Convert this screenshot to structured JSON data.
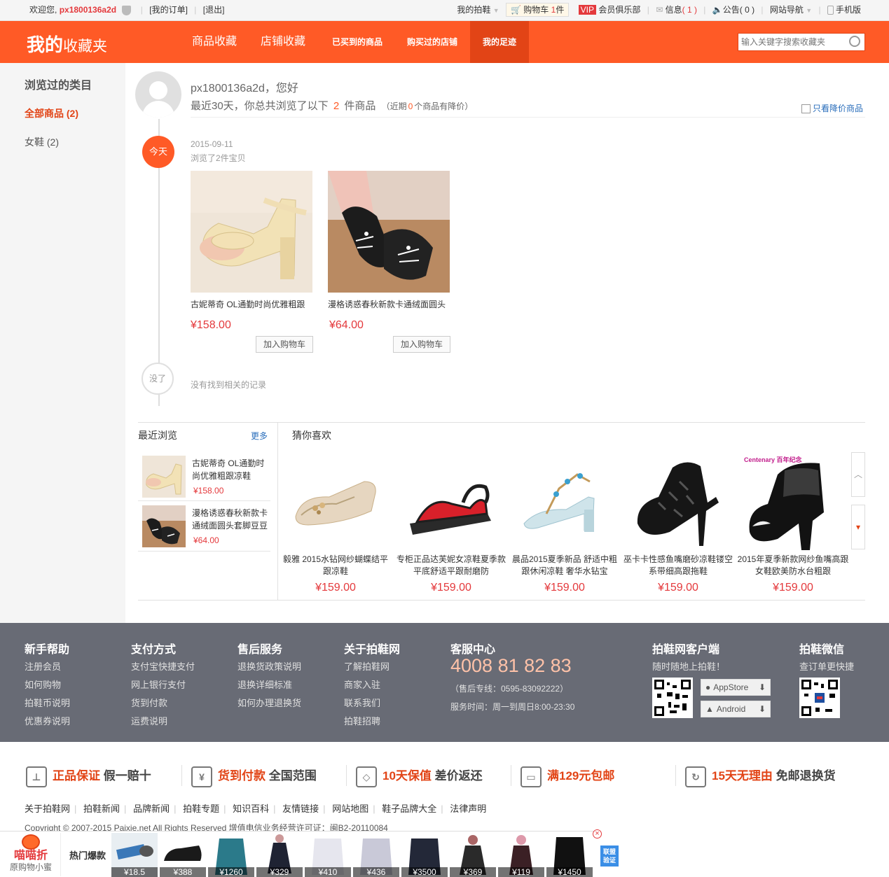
{
  "topbar": {
    "welcome": "欢迎您,",
    "username": "px1800136a2d",
    "my_orders": "[我的订单]",
    "logout": "[退出]",
    "my_paixie": "我的拍鞋",
    "cart_label": "购物车",
    "cart_count": "1",
    "cart_unit": "件",
    "vip_badge": "VIP",
    "vip_club": "会员俱乐部",
    "messages_label": "信息",
    "messages_count": "( 1 )",
    "notice_label": "公告",
    "notice_count": "( 0 )",
    "site_nav": "网站导航",
    "mobile": "手机版"
  },
  "header": {
    "logo_main": "我的",
    "logo_sub": "收藏夹",
    "nav": [
      "商品收藏",
      "店铺收藏",
      "已买到的商品",
      "购买过的店铺",
      "我的足迹"
    ],
    "search_placeholder": "输入关键字搜索收藏夹"
  },
  "sidebar": {
    "title": "浏览过的类目",
    "items": [
      {
        "label": "全部商品",
        "count": "(2)"
      },
      {
        "label": "女鞋",
        "count": "(2)"
      }
    ]
  },
  "summary": {
    "greeting": "px1800136a2d，您好",
    "line_prefix": "最近30天，你总共浏览了以下",
    "count": "2",
    "line_suffix": "件商品",
    "recent_prefix": "（近期",
    "recent_count": "0",
    "recent_suffix": "个商品有降价）",
    "filter_label": "只看降价商品"
  },
  "timeline": {
    "today_label": "今天",
    "date": "2015-09-11",
    "viewed": "浏览了2件宝贝",
    "none_label": "没了",
    "none_text": "没有找到相关的记录"
  },
  "products": [
    {
      "name": "古妮蒂奇 OL通勤时尚优雅粗跟",
      "price": "¥158.00",
      "button": "加入购物车"
    },
    {
      "name": "漫格诱惑春秋新款卡通绒面圆头",
      "price": "¥64.00",
      "button": "加入购物车"
    }
  ],
  "recent": {
    "title": "最近浏览",
    "more": "更多",
    "items": [
      {
        "name": "古妮蒂奇 OL通勤时尚优雅粗跟凉鞋",
        "price": "¥158.00"
      },
      {
        "name": "漫格诱惑春秋新款卡通绒面圆头套脚豆豆",
        "price": "¥64.00"
      }
    ]
  },
  "guess": {
    "title": "猜你喜欢",
    "items": [
      {
        "name": "毅雅 2015水钻网纱蝴蝶结平跟凉鞋",
        "price": "¥159.00"
      },
      {
        "name": "专柜正品达芙妮女凉鞋夏季款平底舒适平跟耐磨防",
        "price": "¥159.00"
      },
      {
        "name": "晨品2015夏季新品 舒适中粗跟休闲凉鞋 奢华水钻宝",
        "price": "¥159.00"
      },
      {
        "name": "巫卡卡性感鱼嘴磨砂凉鞋镂空系带细高跟拖鞋",
        "price": "¥159.00"
      },
      {
        "name": "2015年夏季新款网纱鱼嘴高跟女鞋欧美防水台粗跟",
        "price": "¥159.00"
      }
    ],
    "brand_text": "Centenary 百年纪念"
  },
  "footer": {
    "cols": [
      {
        "title": "新手帮助",
        "links": [
          "注册会员",
          "如何购物",
          "拍鞋币说明",
          "优惠券说明"
        ]
      },
      {
        "title": "支付方式",
        "links": [
          "支付宝快捷支付",
          "网上银行支付",
          "货到付款",
          "运费说明"
        ]
      },
      {
        "title": "售后服务",
        "links": [
          "退换货政策说明",
          "退换详细标准",
          "如何办理退换货"
        ]
      },
      {
        "title": "关于拍鞋网",
        "links": [
          "了解拍鞋网",
          "商家入驻",
          "联系我们",
          "拍鞋招聘"
        ]
      }
    ],
    "service": {
      "title": "客服中心",
      "phone": "4008 81 82 83",
      "after_sales": "（售后专线：0595-83092222）",
      "hours": "服务时间：周一到周日8:00-23:30"
    },
    "client": {
      "title": "拍鞋网客户端",
      "subtitle": "随时随地上拍鞋！",
      "appstore": "AppStore",
      "android": "Android"
    },
    "wechat": {
      "title": "拍鞋微信",
      "subtitle": "查订单更快捷"
    }
  },
  "guarantees": [
    {
      "highlight": "正品保证",
      "text": "假一赔十"
    },
    {
      "highlight": "货到付款",
      "text": "全国范围"
    },
    {
      "highlight": "10天保值",
      "text": "差价返还"
    },
    {
      "highlight": "满129元包邮",
      "text": ""
    },
    {
      "highlight": "15天无理由",
      "text": "免邮退换货"
    }
  ],
  "bottom_links": [
    "关于拍鞋网",
    "拍鞋新闻",
    "品牌新闻",
    "拍鞋专题",
    "知识百科",
    "友情链接",
    "网站地图",
    "鞋子品牌大全",
    "法律声明"
  ],
  "copyright": "Copyright © 2007-2015 Paixie.net All Rights Reserved 增值电信业务经营许可证：闽B2-20110084",
  "bottombar": {
    "brand": "喵喵折",
    "brand_sub": "原购物小蜜",
    "hot_label": "热门爆款",
    "badge_line1": "联盟",
    "badge_line2": "验证",
    "prices": [
      "¥18.5",
      "¥388",
      "¥1260",
      "¥329",
      "¥410",
      "¥436",
      "¥3500",
      "¥369",
      "¥119",
      "¥1450"
    ],
    "close": "×"
  },
  "colors": {
    "brand_orange": "#ff5a26",
    "nav_active": "#e24416",
    "price_red": "#e4393c",
    "footer_bg": "#686b75"
  }
}
